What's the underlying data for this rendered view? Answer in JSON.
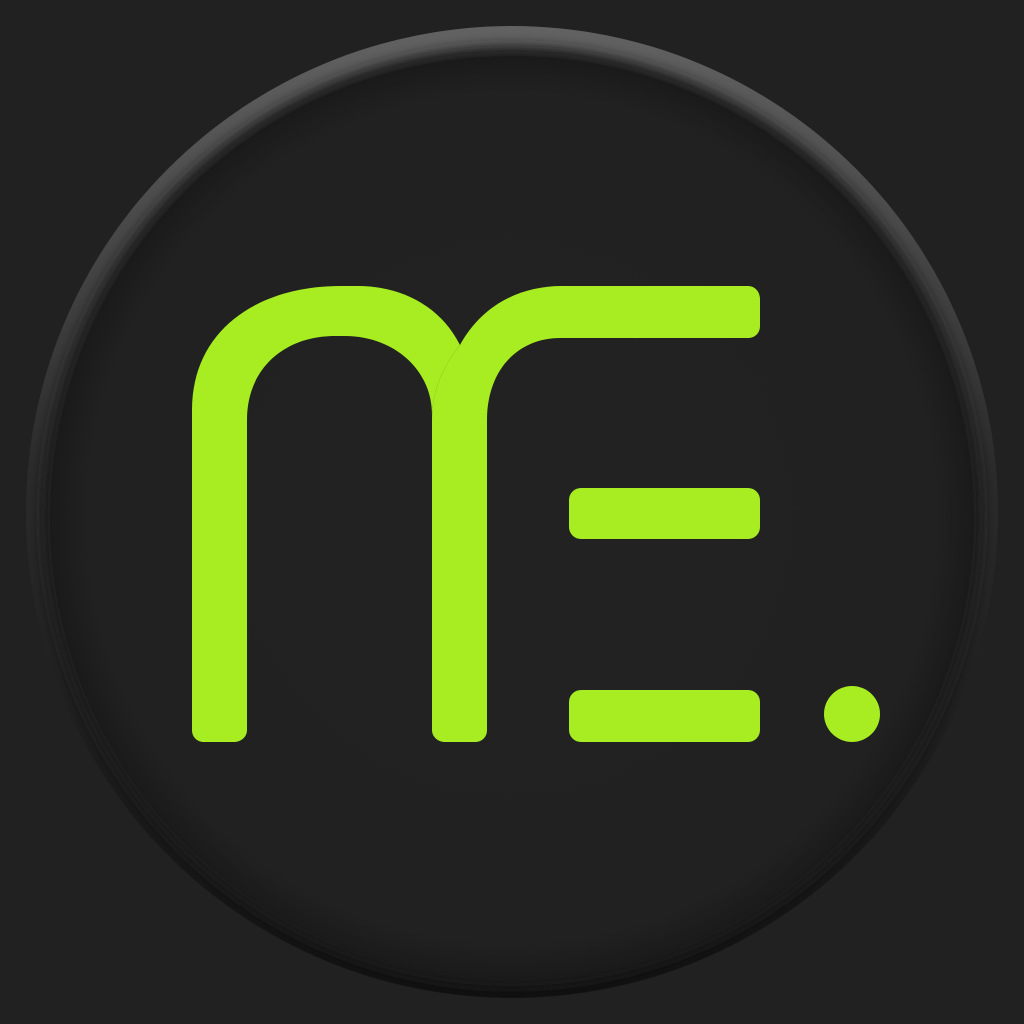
{
  "logo": {
    "mark": "ME.",
    "colors": {
      "page_background": "#212121",
      "badge_face": "#212121",
      "badge_rim_light": "#5a5a5a",
      "badge_rim_dark": "#141414",
      "glyph": "#a8ed22"
    }
  }
}
